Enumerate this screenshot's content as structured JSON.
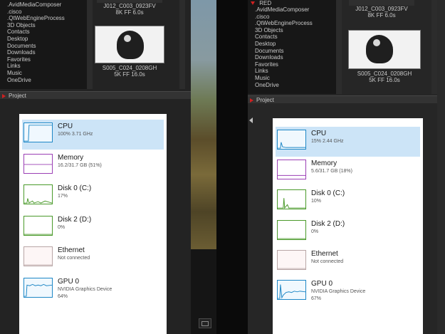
{
  "folders": [
    ".AvidMediaComposer",
    ".cisco",
    ".QtWebEngineProcess",
    "3D Objects",
    "Contacts",
    "Desktop",
    "Documents",
    "Downloads",
    "Favorites",
    "Links",
    "Music",
    "OneDrive"
  ],
  "left": {
    "clips": [
      {
        "name": "J012_C003_0923FV",
        "meta": "8K FF    6.0s"
      },
      {
        "name": "S005_C024_0208GH",
        "meta": "5K FF    16.0s"
      }
    ],
    "project_label": "Project",
    "task_manager": [
      {
        "key": "cpu",
        "title": "CPU",
        "sub": "100%  3.71 GHz",
        "sub2": "",
        "selected": true
      },
      {
        "key": "mem",
        "title": "Memory",
        "sub": "16.2/31.7 GB (51%)",
        "sub2": "",
        "selected": false
      },
      {
        "key": "disk0",
        "title": "Disk 0 (C:)",
        "sub": "17%",
        "sub2": "",
        "selected": false
      },
      {
        "key": "disk2",
        "title": "Disk 2 (D:)",
        "sub": "0%",
        "sub2": "",
        "selected": false
      },
      {
        "key": "eth",
        "title": "Ethernet",
        "sub": "Not connected",
        "sub2": "",
        "selected": false
      },
      {
        "key": "gpu",
        "title": "GPU 0",
        "sub": "NVIDIA Graphics Device",
        "sub2": "64%",
        "selected": false
      }
    ]
  },
  "right": {
    "red_label": "RED",
    "clips": [
      {
        "name": "J012_C003_0923FV",
        "meta": "8K FF    6.0s"
      },
      {
        "name": "S005_C024_0208GH",
        "meta": "5K FF    16.0s"
      }
    ],
    "project_label": "Project",
    "task_manager": [
      {
        "key": "cpu",
        "title": "CPU",
        "sub": "15%  2.44 GHz",
        "sub2": "",
        "selected": true
      },
      {
        "key": "mem",
        "title": "Memory",
        "sub": "5.6/31.7 GB (18%)",
        "sub2": "",
        "selected": false
      },
      {
        "key": "disk0",
        "title": "Disk 0 (C:)",
        "sub": "10%",
        "sub2": "",
        "selected": false
      },
      {
        "key": "disk2",
        "title": "Disk 2 (D:)",
        "sub": "0%",
        "sub2": "",
        "selected": false
      },
      {
        "key": "eth",
        "title": "Ethernet",
        "sub": "Not connected",
        "sub2": "",
        "selected": false
      },
      {
        "key": "gpu",
        "title": "GPU 0",
        "sub": "NVIDIA Graphics Device",
        "sub2": "67%",
        "selected": false
      }
    ]
  },
  "colors": {
    "cpu_graph": "#1e87c6",
    "memory_graph": "#9b3fb5",
    "disk_graph": "#4a9a2a",
    "ethernet_graph": "#b8a6a6",
    "selection": "#cce4f7",
    "project_marker": "#d02020"
  }
}
